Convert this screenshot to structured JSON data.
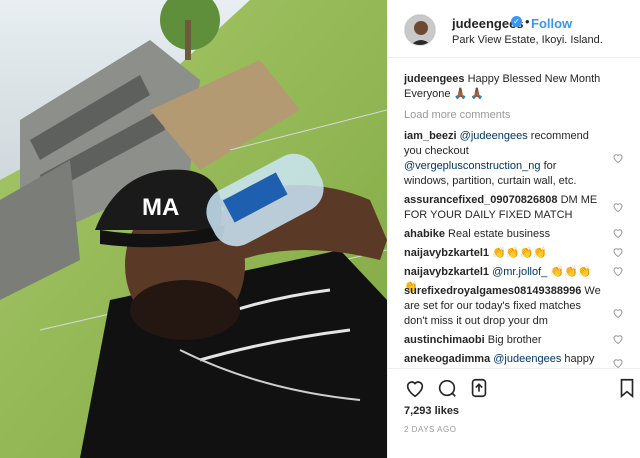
{
  "post": {
    "username": "judeengees",
    "follow_label": "Follow",
    "separator": "•",
    "verified_mark": "✓",
    "location": "Park View Estate, Ikoyi. Island."
  },
  "caption": {
    "username": "judeengees",
    "text": "Happy Blessed New Month Everyone 🙏🏾 🙏🏾"
  },
  "load_more": "Load more comments",
  "comments": [
    {
      "user": "iam_beezi",
      "mention": "@judeengees",
      "text": " recommend you checkout ",
      "mention2": "@vergeplusconstruction_ng",
      "text2": " for windows, partition, curtain wall, etc."
    },
    {
      "user": "assurancefixed_09070826808",
      "text": "DM ME FOR YOUR DAILY FIXED MATCH"
    },
    {
      "user": "ahabike",
      "text": "Real estate business"
    },
    {
      "user": "naijavybzkartel1",
      "text": "👏👏👏👏"
    },
    {
      "user": "naijavybzkartel1",
      "mention": "@mr.jollof_",
      "text": " 👏👏👏👏"
    },
    {
      "user": "surefixedroyalgames08149388996",
      "text": "We are set for our today's fixed matches don't miss it out drop your dm"
    },
    {
      "user": "austinchimaobi",
      "text": "Big brother"
    },
    {
      "user": "anekeogadimma",
      "mention": "@judeengees",
      "text": " happy"
    }
  ],
  "likes": "7,293 likes",
  "timestamp": "2 DAYS AGO",
  "icons": {
    "like": "heart-icon",
    "comment": "comment-bubble-icon",
    "share": "share-icon",
    "save": "bookmark-icon"
  },
  "colors": {
    "link": "#3897f0",
    "mention": "#003569",
    "muted": "#999999",
    "text": "#262626"
  }
}
